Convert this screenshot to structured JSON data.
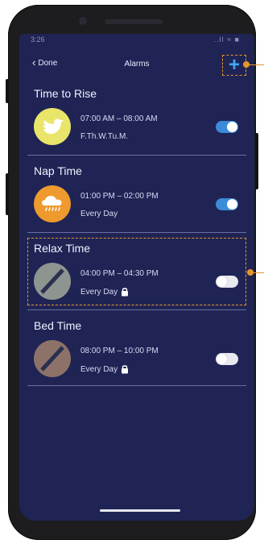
{
  "status_bar": {
    "time": "3:26",
    "icons": "..ll ≈ ■"
  },
  "nav": {
    "back_label": "Done",
    "title": "Alarms",
    "add_label": "+"
  },
  "alarms": [
    {
      "name": "Time to Rise",
      "times": "07:00 AM – 08:00 AM",
      "days": "F.Th.W.Tu.M.",
      "enabled": true,
      "locked": false,
      "icon": "bird-icon",
      "icon_color": "#e9e56a"
    },
    {
      "name": "Nap Time",
      "times": "01:00 PM – 02:00 PM",
      "days": "Every Day",
      "enabled": true,
      "locked": false,
      "icon": "rain-cloud-icon",
      "icon_color": "#ee9a2e"
    },
    {
      "name": "Relax Time",
      "times": "04:00 PM – 04:30 PM",
      "days": "Every Day",
      "enabled": false,
      "locked": true,
      "icon": "disabled-icon",
      "icon_color": "#8e9490"
    },
    {
      "name": "Bed Time",
      "times": "08:00 PM – 10:00 PM",
      "days": "Every Day",
      "enabled": false,
      "locked": true,
      "icon": "disabled-icon",
      "icon_color": "#8c7268"
    }
  ],
  "colors": {
    "background": "#1f2454",
    "accent": "#3fa9f5",
    "toggle_on": "#3b8bd8",
    "annotation": "#e7962a"
  }
}
